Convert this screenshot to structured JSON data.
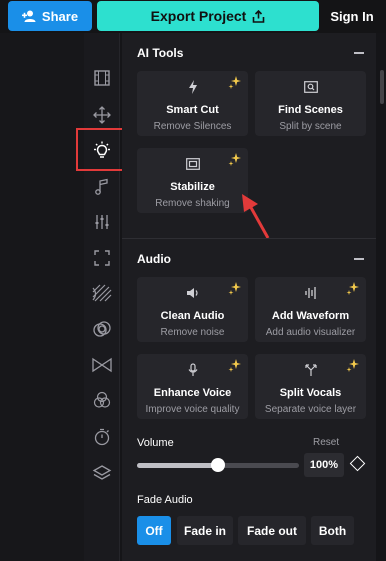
{
  "topbar": {
    "share_label": "Share",
    "export_label": "Export Project",
    "signin_label": "Sign In"
  },
  "rail": {
    "icons": [
      "film-icon",
      "move-icon",
      "lightbulb-icon",
      "music-icon",
      "sliders-icon",
      "fullscreen-icon",
      "pattern-icon",
      "rings-icon",
      "transition-icon",
      "color-circles-icon",
      "timer-icon",
      "layers-icon"
    ],
    "active": "lightbulb-icon"
  },
  "ai_tools": {
    "title": "AI Tools",
    "cards": [
      {
        "title": "Smart Cut",
        "subtitle": "Remove Silences",
        "icon": "bolt-icon"
      },
      {
        "title": "Find Scenes",
        "subtitle": "Split by scene",
        "icon": "search-frame-icon"
      },
      {
        "title": "Stabilize",
        "subtitle": "Remove shaking",
        "icon": "stabilize-icon"
      }
    ]
  },
  "audio": {
    "title": "Audio",
    "cards": [
      {
        "title": "Clean Audio",
        "subtitle": "Remove noise",
        "icon": "speaker-icon"
      },
      {
        "title": "Add Waveform",
        "subtitle": "Add audio visualizer",
        "icon": "waveform-icon"
      },
      {
        "title": "Enhance Voice",
        "subtitle": "Improve voice quality",
        "icon": "microphone-icon"
      },
      {
        "title": "Split Vocals",
        "subtitle": "Separate voice layer",
        "icon": "split-icon"
      }
    ],
    "volume_label": "Volume",
    "reset_label": "Reset",
    "volume_value": "100%",
    "volume_level": 0.5,
    "fade_label": "Fade Audio",
    "fade_options": [
      "Off",
      "Fade in",
      "Fade out",
      "Both"
    ],
    "fade_selected": "Off"
  },
  "colors": {
    "accent_blue": "#1a8fe8",
    "export_teal": "#2de0cf",
    "highlight_red": "#e23a3a",
    "sparkle_yellow": "#f2c94c"
  }
}
